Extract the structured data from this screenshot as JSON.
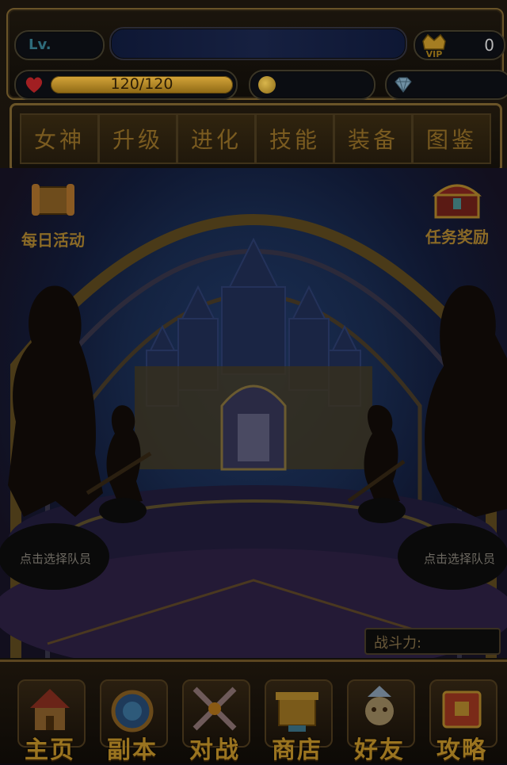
{
  "status": {
    "lv_label": "Lv.",
    "vip_label": "VIP",
    "vip_value": "0",
    "hp_text": "120/120",
    "coins": "",
    "gems": ""
  },
  "tabs": [
    {
      "label": "女神"
    },
    {
      "label": "升级"
    },
    {
      "label": "进化"
    },
    {
      "label": "技能"
    },
    {
      "label": "装备"
    },
    {
      "label": "图鉴"
    }
  ],
  "side": {
    "daily_label": "每日活动",
    "reward_label": "任务奖励"
  },
  "scene": {
    "pick_left": "点击选择队员",
    "pick_right": "点击选择队员",
    "power_label": "战斗力:"
  },
  "nav": [
    {
      "label": "主页",
      "icon": "house-icon"
    },
    {
      "label": "副本",
      "icon": "portal-icon"
    },
    {
      "label": "对战",
      "icon": "crossed-swords-icon"
    },
    {
      "label": "商店",
      "icon": "shop-icon"
    },
    {
      "label": "好友",
      "icon": "friend-icon"
    },
    {
      "label": "攻略",
      "icon": "book-icon"
    }
  ],
  "colors": {
    "gold": "#9a7420",
    "frame": "#6a5428",
    "hp_bar": "#d6a63a",
    "sky": "#1b2f54"
  }
}
